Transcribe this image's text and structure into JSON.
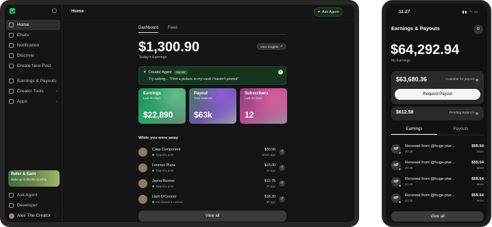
{
  "sidebar": {
    "items": [
      {
        "label": "Home",
        "icon": "home-icon",
        "active": true
      },
      {
        "label": "Chats",
        "icon": "chat-icon"
      },
      {
        "label": "Notification",
        "icon": "bell-icon"
      },
      {
        "label": "Discover",
        "icon": "compass-icon"
      },
      {
        "label": "Create New Post",
        "icon": "plus-square-icon"
      },
      {
        "label": "Earnings & Payouts",
        "icon": "dollar-icon"
      },
      {
        "label": "Creator Tools",
        "icon": "tools-icon"
      },
      {
        "label": "Apps",
        "icon": "grid-icon"
      }
    ],
    "refer": {
      "title": "Refer & Earn",
      "subtitle": "Make up to $5,000 monthly"
    },
    "bottom": [
      {
        "label": "Ask Agent",
        "icon": "sparkle-icon"
      },
      {
        "label": "Developer",
        "icon": "code-icon"
      }
    ],
    "user": {
      "name": "Alex The Creator"
    }
  },
  "header": {
    "title": "Home",
    "ask_agent": "Ask Agent"
  },
  "tabs": [
    "Dashboard",
    "Feed"
  ],
  "dashboard": {
    "balance": "$1,300.90",
    "balance_label": "Today's Earnings",
    "insights_label": "View Insights"
  },
  "agent": {
    "title": "Creator Agent",
    "badge": "ONLINE",
    "prompt": "Try asking... \"Find a picture in my vault I haven't posted\""
  },
  "stats": [
    {
      "label": "Earnings",
      "sub": "Last 30 days",
      "value": "$22,890"
    },
    {
      "label": "Payout",
      "sub": "Total balance",
      "value": "$63k"
    },
    {
      "label": "Subscribers",
      "sub": "Last 30 days",
      "value": "12"
    }
  ],
  "away": {
    "title": "While you were away",
    "rows": [
      {
        "name": "Casp Component",
        "desc": "Tipped a post",
        "amount": "$30.50",
        "time": "10min ago"
      },
      {
        "name": "Lorenzo Pizza",
        "desc": "Tipped a post",
        "amount": "$15.00",
        "time": "1h ago"
      },
      {
        "name": "Jayna Runner",
        "desc": "Tipped a post",
        "amount": "$12.75",
        "time": "2h ago"
      },
      {
        "name": "Liam O'Connor",
        "desc": "Purchased a content",
        "amount": "$18.20",
        "time": "3h ago"
      }
    ],
    "view_all": "View all"
  },
  "phone": {
    "time": "11:27",
    "title": "Earnings & Payouts",
    "balance": "$64,292.94",
    "balance_label": "My Earnings",
    "available": {
      "amount": "$63,680.36",
      "label": "Available for payout",
      "button": "Request Payout"
    },
    "pending": {
      "amount": "$612.58",
      "label": "Pending Balance"
    },
    "tabs": [
      "Earnings",
      "Payouts"
    ],
    "rows": [
      {
        "initials": "HP",
        "name": "Renewal from @huge-ptar...",
        "time": "20:35",
        "amount": "$55.54",
        "more": "More"
      },
      {
        "initials": "HP",
        "name": "Renewal from @huge-ptar...",
        "time": "20:35",
        "amount": "$55.54",
        "more": "More"
      },
      {
        "initials": "HP",
        "name": "Renewal from @huge-ptar...",
        "time": "20:35",
        "amount": "$55.54",
        "more": "More"
      },
      {
        "initials": "HP",
        "name": "Renewal from @huge-ptar...",
        "time": "20:35",
        "amount": "$55.54",
        "more": "More"
      }
    ],
    "view_all": "View all"
  }
}
